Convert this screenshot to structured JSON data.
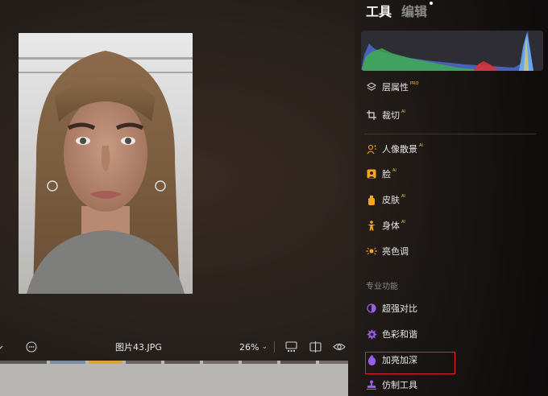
{
  "canvas": {
    "filename": "图片43.JPG",
    "zoom": "26%",
    "zoom_caret": "⌄"
  },
  "panel": {
    "tabs": [
      {
        "label": "工具",
        "active": true
      },
      {
        "label": "编辑",
        "active": false
      }
    ],
    "tools": [
      {
        "label": "层属性",
        "badge": "PRO",
        "icon": "layers-icon"
      },
      {
        "label": "裁切",
        "badge": "AI",
        "icon": "crop-icon"
      },
      {
        "label": "人像散景",
        "badge": "AI",
        "icon": "portrait-bokeh-icon"
      },
      {
        "label": "脸",
        "badge": "AI",
        "icon": "face-icon"
      },
      {
        "label": "皮肤",
        "badge": "AI",
        "icon": "skin-icon"
      },
      {
        "label": "身体",
        "badge": "AI",
        "icon": "body-icon"
      },
      {
        "label": "亮色调",
        "badge": "",
        "icon": "bright-tones-icon"
      }
    ],
    "pro_section_title": "专业功能",
    "pro_tools": [
      {
        "label": "超强对比",
        "icon": "super-contrast-icon"
      },
      {
        "label": "色彩和谐",
        "icon": "color-harmony-icon"
      },
      {
        "label": "加亮加深",
        "icon": "dodge-burn-icon"
      },
      {
        "label": "仿制工具",
        "icon": "clone-stamp-icon"
      }
    ]
  },
  "colors": {
    "accent_orange": "#f5a623",
    "accent_purple": "#9b5cf0",
    "highlight_red": "#e0222a",
    "badge_yellow": "#f1c24b"
  }
}
